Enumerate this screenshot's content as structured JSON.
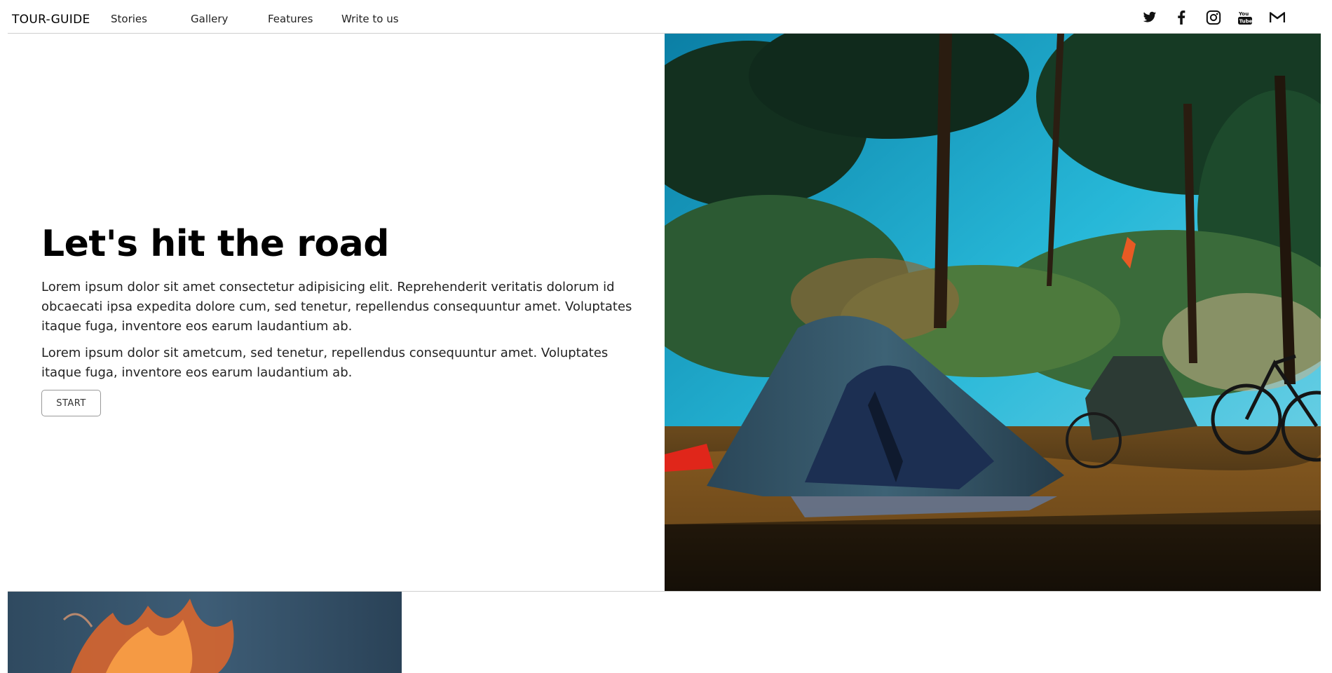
{
  "header": {
    "brand": "TOUR-GUIDE",
    "nav": [
      {
        "label": "Stories"
      },
      {
        "label": "Gallery"
      },
      {
        "label": "Features"
      },
      {
        "label": "Write to us"
      }
    ],
    "social": [
      "twitter-icon",
      "facebook-icon",
      "instagram-icon",
      "youtube-icon",
      "gmail-icon"
    ]
  },
  "hero": {
    "title": "Let's hit the road",
    "paragraph1": "Lorem ipsum dolor sit amet consectetur adipisicing elit. Reprehenderit veritatis dolorum id obcaecati ipsa expedita dolore cum, sed tenetur, repellendus consequuntur amet. Voluptates itaque fuga, inventore eos earum laudantium ab.",
    "paragraph2": "Lorem ipsum dolor sit ametcum, sed tenetur, repellendus consequuntur amet. Voluptates itaque fuga, inventore eos earum laudantium ab.",
    "button": "START"
  },
  "colors": {
    "text": "#111111",
    "border": "#cfcfcf",
    "sky": "#1aa7c9",
    "tent": "#2f4a5c"
  }
}
